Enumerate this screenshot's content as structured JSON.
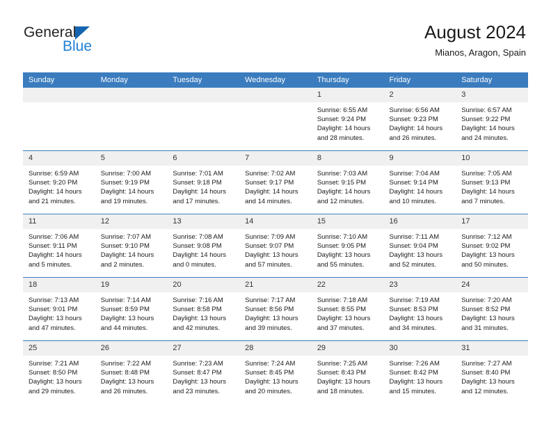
{
  "brand": {
    "name_part1": "General",
    "name_part2": "Blue",
    "logo_icon": "triangle-flag-icon",
    "accent_color": "#2181d4",
    "dark_color": "#231f20"
  },
  "header": {
    "title": "August 2024",
    "subtitle": "Mianos, Aragon, Spain"
  },
  "calendar": {
    "header_bg": "#3a7cbe",
    "daynum_bg": "#f0f0f0",
    "weekdays": [
      "Sunday",
      "Monday",
      "Tuesday",
      "Wednesday",
      "Thursday",
      "Friday",
      "Saturday"
    ],
    "weeks": [
      [
        {
          "day": "",
          "empty": true,
          "sunrise": "",
          "sunset": "",
          "daylight1": "",
          "daylight2": ""
        },
        {
          "day": "",
          "empty": true,
          "sunrise": "",
          "sunset": "",
          "daylight1": "",
          "daylight2": ""
        },
        {
          "day": "",
          "empty": true,
          "sunrise": "",
          "sunset": "",
          "daylight1": "",
          "daylight2": ""
        },
        {
          "day": "",
          "empty": true,
          "sunrise": "",
          "sunset": "",
          "daylight1": "",
          "daylight2": ""
        },
        {
          "day": "1",
          "empty": false,
          "sunrise": "Sunrise: 6:55 AM",
          "sunset": "Sunset: 9:24 PM",
          "daylight1": "Daylight: 14 hours",
          "daylight2": "and 28 minutes."
        },
        {
          "day": "2",
          "empty": false,
          "sunrise": "Sunrise: 6:56 AM",
          "sunset": "Sunset: 9:23 PM",
          "daylight1": "Daylight: 14 hours",
          "daylight2": "and 26 minutes."
        },
        {
          "day": "3",
          "empty": false,
          "sunrise": "Sunrise: 6:57 AM",
          "sunset": "Sunset: 9:22 PM",
          "daylight1": "Daylight: 14 hours",
          "daylight2": "and 24 minutes."
        }
      ],
      [
        {
          "day": "4",
          "empty": false,
          "sunrise": "Sunrise: 6:59 AM",
          "sunset": "Sunset: 9:20 PM",
          "daylight1": "Daylight: 14 hours",
          "daylight2": "and 21 minutes."
        },
        {
          "day": "5",
          "empty": false,
          "sunrise": "Sunrise: 7:00 AM",
          "sunset": "Sunset: 9:19 PM",
          "daylight1": "Daylight: 14 hours",
          "daylight2": "and 19 minutes."
        },
        {
          "day": "6",
          "empty": false,
          "sunrise": "Sunrise: 7:01 AM",
          "sunset": "Sunset: 9:18 PM",
          "daylight1": "Daylight: 14 hours",
          "daylight2": "and 17 minutes."
        },
        {
          "day": "7",
          "empty": false,
          "sunrise": "Sunrise: 7:02 AM",
          "sunset": "Sunset: 9:17 PM",
          "daylight1": "Daylight: 14 hours",
          "daylight2": "and 14 minutes."
        },
        {
          "day": "8",
          "empty": false,
          "sunrise": "Sunrise: 7:03 AM",
          "sunset": "Sunset: 9:15 PM",
          "daylight1": "Daylight: 14 hours",
          "daylight2": "and 12 minutes."
        },
        {
          "day": "9",
          "empty": false,
          "sunrise": "Sunrise: 7:04 AM",
          "sunset": "Sunset: 9:14 PM",
          "daylight1": "Daylight: 14 hours",
          "daylight2": "and 10 minutes."
        },
        {
          "day": "10",
          "empty": false,
          "sunrise": "Sunrise: 7:05 AM",
          "sunset": "Sunset: 9:13 PM",
          "daylight1": "Daylight: 14 hours",
          "daylight2": "and 7 minutes."
        }
      ],
      [
        {
          "day": "11",
          "empty": false,
          "sunrise": "Sunrise: 7:06 AM",
          "sunset": "Sunset: 9:11 PM",
          "daylight1": "Daylight: 14 hours",
          "daylight2": "and 5 minutes."
        },
        {
          "day": "12",
          "empty": false,
          "sunrise": "Sunrise: 7:07 AM",
          "sunset": "Sunset: 9:10 PM",
          "daylight1": "Daylight: 14 hours",
          "daylight2": "and 2 minutes."
        },
        {
          "day": "13",
          "empty": false,
          "sunrise": "Sunrise: 7:08 AM",
          "sunset": "Sunset: 9:08 PM",
          "daylight1": "Daylight: 14 hours",
          "daylight2": "and 0 minutes."
        },
        {
          "day": "14",
          "empty": false,
          "sunrise": "Sunrise: 7:09 AM",
          "sunset": "Sunset: 9:07 PM",
          "daylight1": "Daylight: 13 hours",
          "daylight2": "and 57 minutes."
        },
        {
          "day": "15",
          "empty": false,
          "sunrise": "Sunrise: 7:10 AM",
          "sunset": "Sunset: 9:05 PM",
          "daylight1": "Daylight: 13 hours",
          "daylight2": "and 55 minutes."
        },
        {
          "day": "16",
          "empty": false,
          "sunrise": "Sunrise: 7:11 AM",
          "sunset": "Sunset: 9:04 PM",
          "daylight1": "Daylight: 13 hours",
          "daylight2": "and 52 minutes."
        },
        {
          "day": "17",
          "empty": false,
          "sunrise": "Sunrise: 7:12 AM",
          "sunset": "Sunset: 9:02 PM",
          "daylight1": "Daylight: 13 hours",
          "daylight2": "and 50 minutes."
        }
      ],
      [
        {
          "day": "18",
          "empty": false,
          "sunrise": "Sunrise: 7:13 AM",
          "sunset": "Sunset: 9:01 PM",
          "daylight1": "Daylight: 13 hours",
          "daylight2": "and 47 minutes."
        },
        {
          "day": "19",
          "empty": false,
          "sunrise": "Sunrise: 7:14 AM",
          "sunset": "Sunset: 8:59 PM",
          "daylight1": "Daylight: 13 hours",
          "daylight2": "and 44 minutes."
        },
        {
          "day": "20",
          "empty": false,
          "sunrise": "Sunrise: 7:16 AM",
          "sunset": "Sunset: 8:58 PM",
          "daylight1": "Daylight: 13 hours",
          "daylight2": "and 42 minutes."
        },
        {
          "day": "21",
          "empty": false,
          "sunrise": "Sunrise: 7:17 AM",
          "sunset": "Sunset: 8:56 PM",
          "daylight1": "Daylight: 13 hours",
          "daylight2": "and 39 minutes."
        },
        {
          "day": "22",
          "empty": false,
          "sunrise": "Sunrise: 7:18 AM",
          "sunset": "Sunset: 8:55 PM",
          "daylight1": "Daylight: 13 hours",
          "daylight2": "and 37 minutes."
        },
        {
          "day": "23",
          "empty": false,
          "sunrise": "Sunrise: 7:19 AM",
          "sunset": "Sunset: 8:53 PM",
          "daylight1": "Daylight: 13 hours",
          "daylight2": "and 34 minutes."
        },
        {
          "day": "24",
          "empty": false,
          "sunrise": "Sunrise: 7:20 AM",
          "sunset": "Sunset: 8:52 PM",
          "daylight1": "Daylight: 13 hours",
          "daylight2": "and 31 minutes."
        }
      ],
      [
        {
          "day": "25",
          "empty": false,
          "sunrise": "Sunrise: 7:21 AM",
          "sunset": "Sunset: 8:50 PM",
          "daylight1": "Daylight: 13 hours",
          "daylight2": "and 29 minutes."
        },
        {
          "day": "26",
          "empty": false,
          "sunrise": "Sunrise: 7:22 AM",
          "sunset": "Sunset: 8:48 PM",
          "daylight1": "Daylight: 13 hours",
          "daylight2": "and 26 minutes."
        },
        {
          "day": "27",
          "empty": false,
          "sunrise": "Sunrise: 7:23 AM",
          "sunset": "Sunset: 8:47 PM",
          "daylight1": "Daylight: 13 hours",
          "daylight2": "and 23 minutes."
        },
        {
          "day": "28",
          "empty": false,
          "sunrise": "Sunrise: 7:24 AM",
          "sunset": "Sunset: 8:45 PM",
          "daylight1": "Daylight: 13 hours",
          "daylight2": "and 20 minutes."
        },
        {
          "day": "29",
          "empty": false,
          "sunrise": "Sunrise: 7:25 AM",
          "sunset": "Sunset: 8:43 PM",
          "daylight1": "Daylight: 13 hours",
          "daylight2": "and 18 minutes."
        },
        {
          "day": "30",
          "empty": false,
          "sunrise": "Sunrise: 7:26 AM",
          "sunset": "Sunset: 8:42 PM",
          "daylight1": "Daylight: 13 hours",
          "daylight2": "and 15 minutes."
        },
        {
          "day": "31",
          "empty": false,
          "sunrise": "Sunrise: 7:27 AM",
          "sunset": "Sunset: 8:40 PM",
          "daylight1": "Daylight: 13 hours",
          "daylight2": "and 12 minutes."
        }
      ]
    ]
  }
}
